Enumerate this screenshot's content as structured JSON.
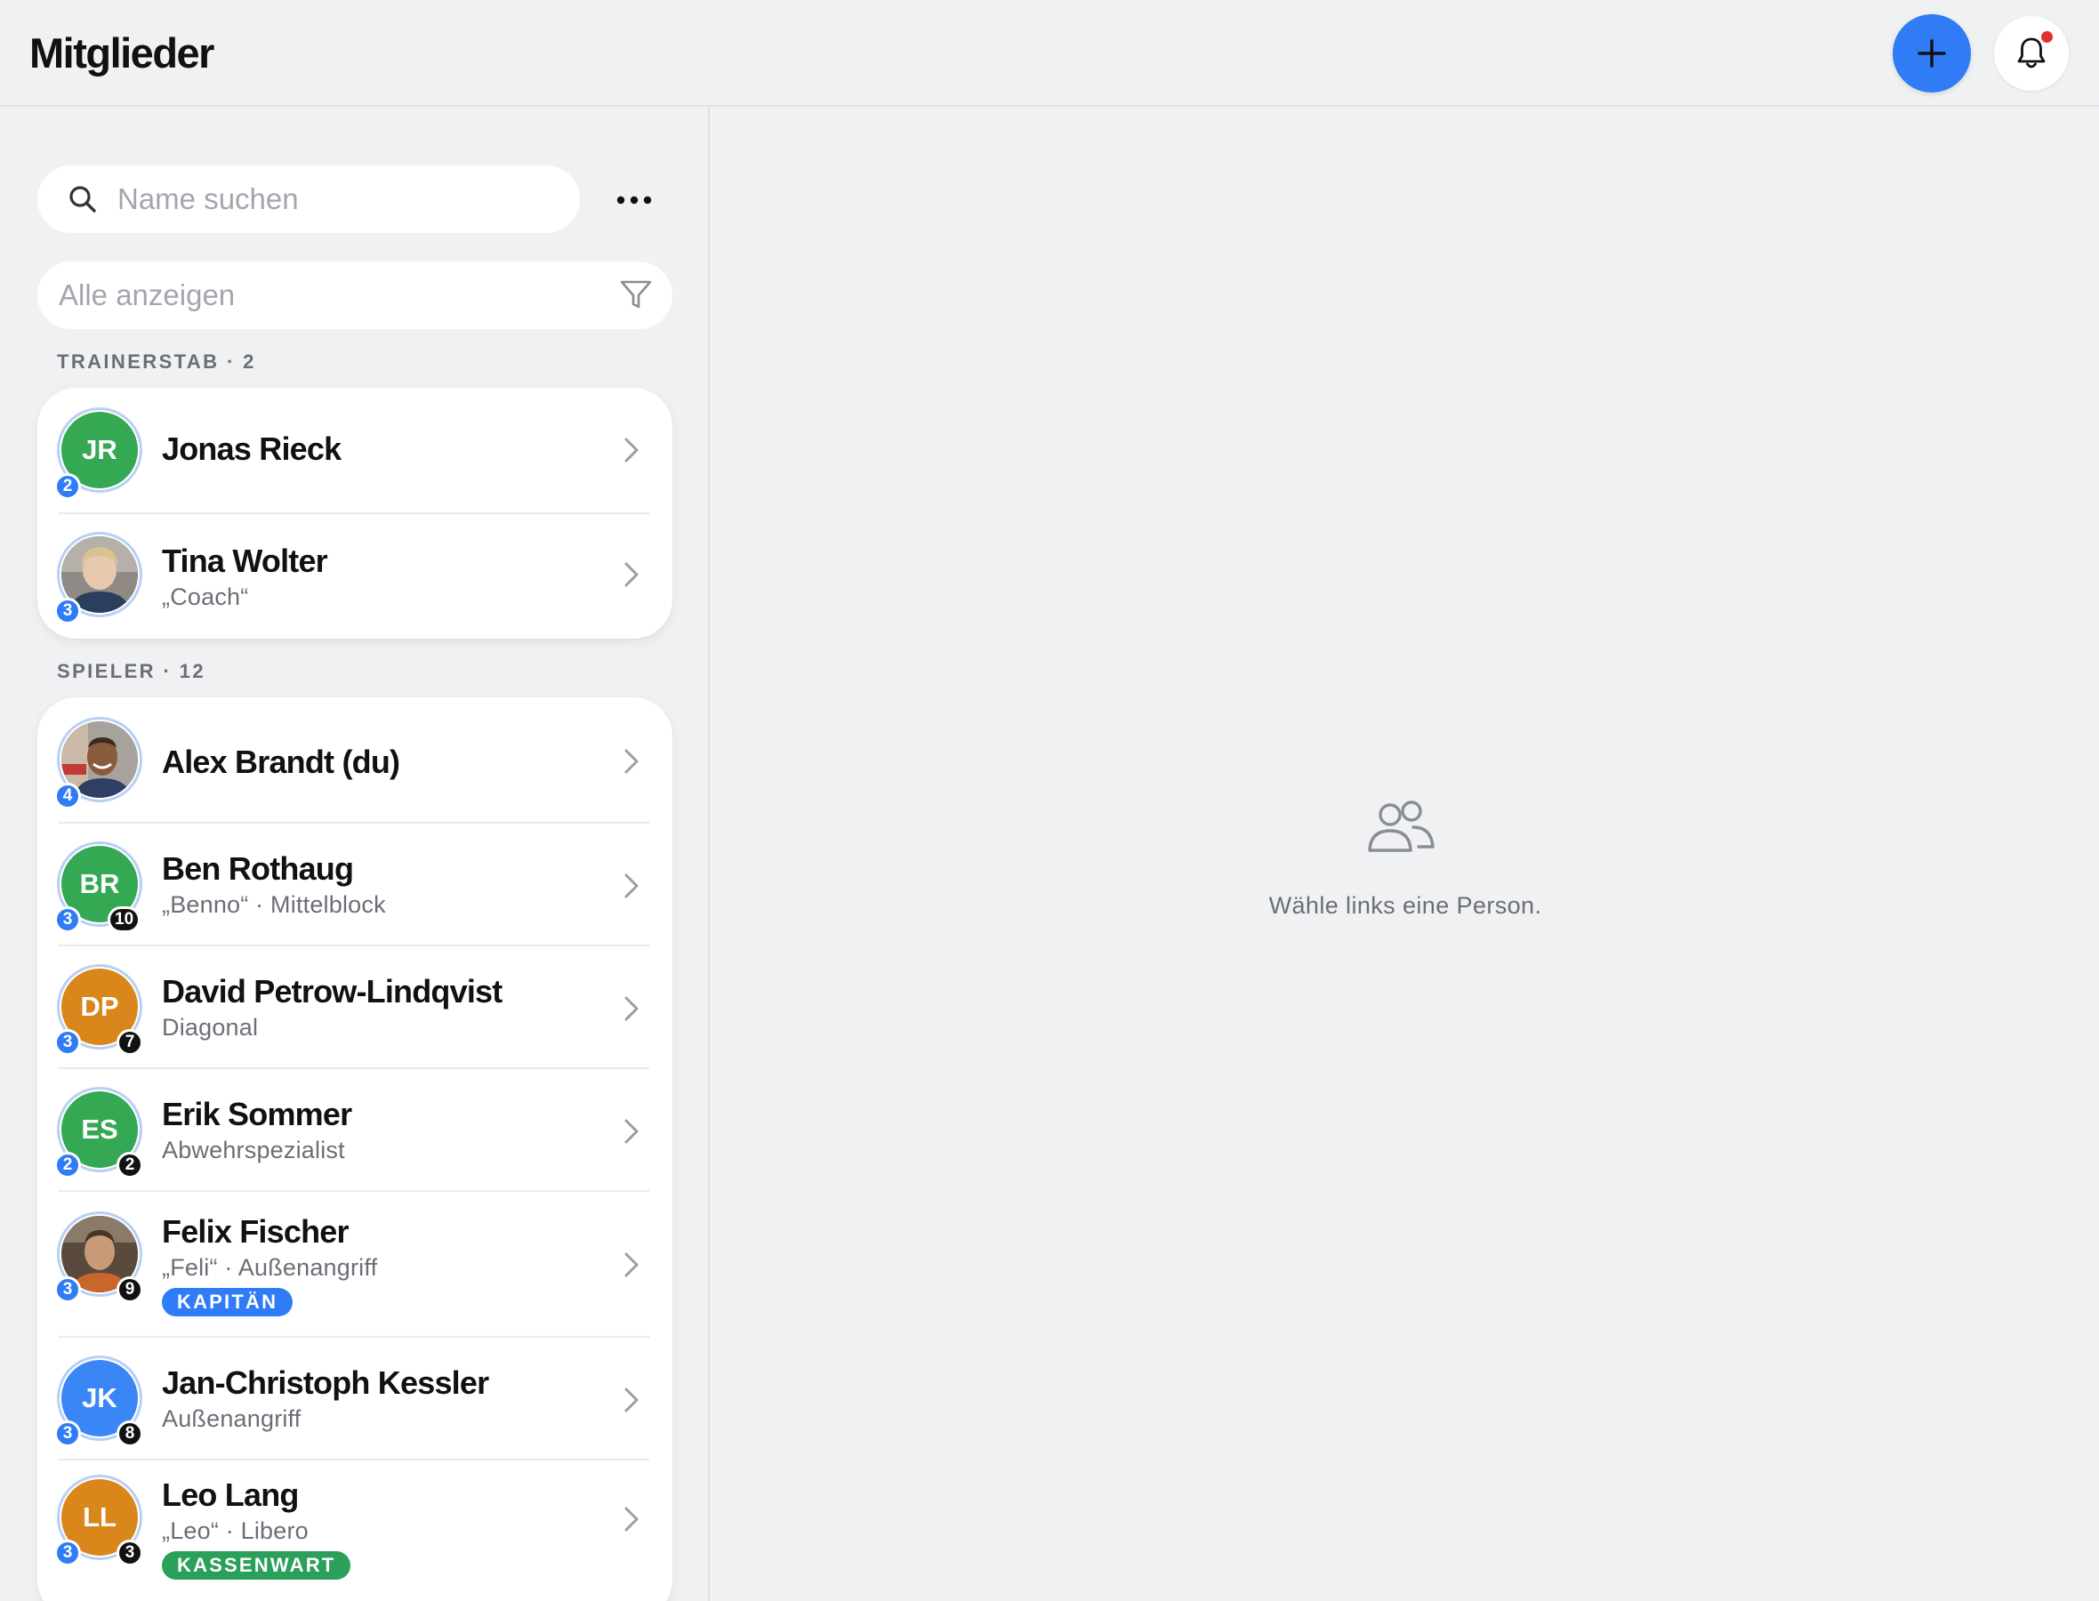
{
  "header": {
    "title": "Mitglieder",
    "add_icon": "plus-icon",
    "bell_icon": "bell-icon",
    "has_unread_notifications": true
  },
  "sidebar": {
    "search": {
      "placeholder": "Name suchen",
      "value": ""
    },
    "more_icon": "ellipsis-icon",
    "filter": {
      "value": "Alle anzeigen",
      "icon": "filter-icon"
    },
    "sections": [
      {
        "label": "TRAINERSTAB · 2",
        "members": [
          {
            "name": "Jonas Rieck",
            "initials": "JR",
            "avatar_color": "#34a853",
            "level": "2"
          },
          {
            "name": "Tina Wolter",
            "subtitle": "„Coach“",
            "photo": "portrait-photo",
            "level": "3"
          }
        ]
      },
      {
        "label": "SPIELER · 12",
        "members": [
          {
            "name": "Alex Brandt (du)",
            "photo": "portrait-photo",
            "level": "4"
          },
          {
            "name": "Ben Rothaug",
            "subtitle": "„Benno“ · Mittelblock",
            "initials": "BR",
            "avatar_color": "#34a853",
            "level": "3",
            "jersey": "10"
          },
          {
            "name": "David Petrow-Lindqvist",
            "subtitle": "Diagonal",
            "initials": "DP",
            "avatar_color": "#d9861a",
            "level": "3",
            "jersey": "7"
          },
          {
            "name": "Erik Sommer",
            "subtitle": "Abwehrspezialist",
            "initials": "ES",
            "avatar_color": "#34a853",
            "level": "2",
            "jersey": "2"
          },
          {
            "name": "Felix Fischer",
            "subtitle": "„Feli“ · Außenangriff",
            "photo": "portrait-photo",
            "level": "3",
            "jersey": "9",
            "tag": "KAPITÄN",
            "tag_color": "#2f7cf6"
          },
          {
            "name": "Jan-Christoph Kessler",
            "subtitle": "Außenangriff",
            "initials": "JK",
            "avatar_color": "#3b86f5",
            "level": "3",
            "jersey": "8"
          },
          {
            "name": "Leo Lang",
            "subtitle": "„Leo“ · Libero",
            "initials": "LL",
            "avatar_color": "#d9861a",
            "level": "3",
            "jersey": "3",
            "tag": "KASSENWART",
            "tag_color": "#2aa05a"
          }
        ]
      }
    ]
  },
  "detail": {
    "empty_icon": "people-icon",
    "empty_text": "Wähle links eine Person."
  },
  "colors": {
    "accent": "#2f7cf6",
    "background": "#f0f1f3",
    "notification_dot": "#e0322b"
  }
}
